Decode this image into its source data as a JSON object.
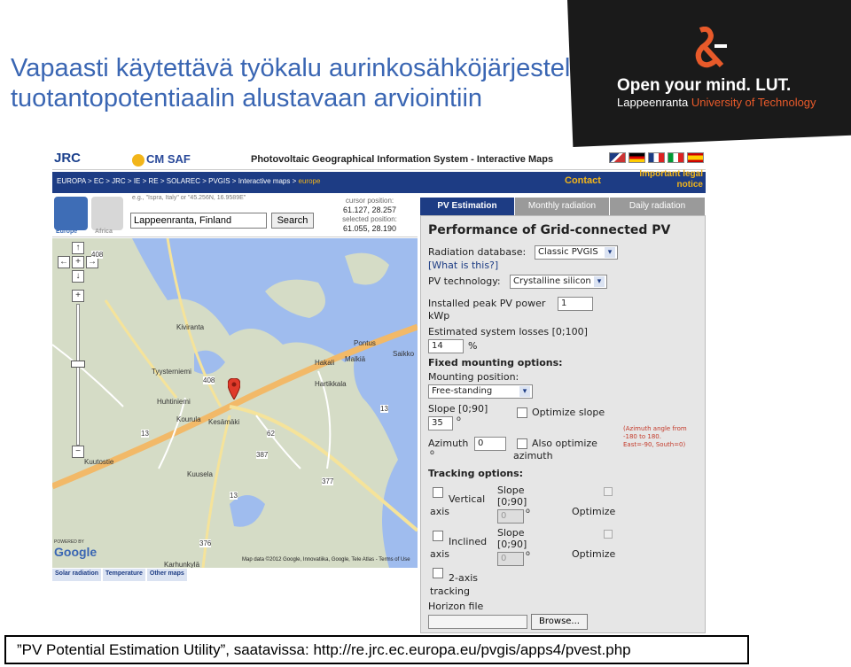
{
  "slide": {
    "title_line1": "Vapaasti käytettävä työkalu aurinkosähköjärjestelmän",
    "title_line2": "tuotantopotentiaalin alustavaan arviointiin",
    "logo_tagline": "Open your mind. LUT.",
    "logo_city": "Lappeenranta",
    "logo_uni": "University of Technology",
    "caption": "”PV Potential Estimation Utility”, saatavissa: http://re.jrc.ec.europa.eu/pvgis/apps4/pvest.php"
  },
  "app": {
    "jrc": "JRC",
    "jrc_sub": "EUROPEAN COMMISSION",
    "cmsaf": "CM SAF",
    "title": "Photovoltaic Geographical Information System - Interactive Maps",
    "crumbs": [
      "EUROPA",
      "EC",
      "JRC",
      "IE",
      "RE",
      "SOLAREC",
      "PVGIS",
      "Interactive maps"
    ],
    "crumb_current": "europe",
    "contact": "Contact",
    "legal_line1": "Important legal",
    "legal_line2": "notice"
  },
  "mapbar": {
    "europe": "Europe",
    "africa": "Africa",
    "hint": "e.g., \"Ispra, Italy\" or \"45.256N, 16.9589E\"",
    "search_value": "Lappeenranta, Finland",
    "search_button": "Search",
    "cursor_label": "cursor position:",
    "cursor_value": "61.127, 28.257",
    "selected_label": "selected position:",
    "selected_value": "61.055, 28.190"
  },
  "map": {
    "places": [
      "Kiviranta",
      "Tyysterniemi",
      "Huhtiniemi",
      "Kourula",
      "Kesämäki",
      "Kuusela",
      "Karhunkylä",
      "Hakali",
      "Malkiä",
      "Hartikkala",
      "Pontus",
      "Saikko",
      "Kuutostie"
    ],
    "road_numbers": [
      "408",
      "408",
      "13",
      "13",
      "62",
      "387",
      "377",
      "376",
      "13"
    ],
    "google": "Google",
    "powered": "POWERED BY",
    "mapdata": "Map data ©2012 Google, Innovatiika, Google, Tele Atlas - Terms of Use"
  },
  "maptabs": [
    "Solar radiation",
    "Temperature",
    "Other maps"
  ],
  "panel": {
    "tabs": [
      "PV Estimation",
      "Monthly radiation",
      "Daily radiation"
    ],
    "heading": "Performance of Grid-connected PV",
    "radiation_db_label": "Radiation database:",
    "radiation_db_value": "Classic PVGIS",
    "what_is_this": "[What is this?]",
    "pv_tech_label": "PV technology:",
    "pv_tech_value": "Crystalline silicon",
    "peak_power_label": "Installed peak PV power",
    "peak_power_value": "1",
    "peak_power_unit": "kWp",
    "losses_label": "Estimated system losses [0;100]",
    "losses_value": "14",
    "losses_unit": "%",
    "fixed_heading": "Fixed mounting options:",
    "mounting_label": "Mounting position:",
    "mounting_value": "Free-standing",
    "slope_label": "Slope [0;90]",
    "slope_value": "35",
    "deg": "o",
    "optimize_slope": "Optimize slope",
    "azimuth_label": "Azimuth",
    "azimuth_value": "0",
    "also_optimize": "Also optimize",
    "azimuth_word": "azimuth",
    "azimuth_note": [
      "(Azimuth angle from",
      "-180 to 180.",
      "East=-90, South=0)"
    ],
    "tracking_heading": "Tracking options:",
    "vertical": "Vertical",
    "inclined": "Inclined",
    "axis": "axis",
    "slope": "Slope",
    "range": "[0;90]",
    "zero": "0",
    "optimize": "Optimize",
    "two_axis": "2-axis",
    "tracking_word": "tracking",
    "horizon": "Horizon file",
    "browse": "Browse..."
  },
  "colors": {
    "title_blue": "#3a66b3",
    "nav_blue": "#1d3c84",
    "gold": "#f2b51a",
    "lut_orange": "#e85a2a"
  }
}
